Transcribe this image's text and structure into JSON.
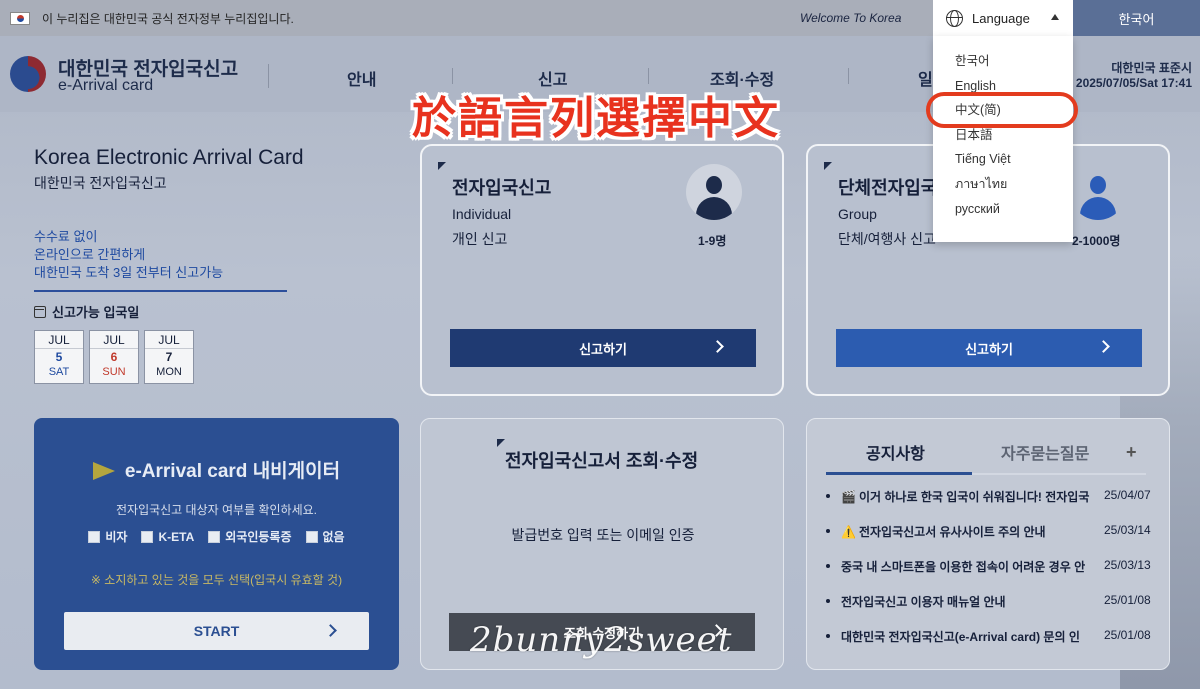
{
  "gov_banner": {
    "text": "이 누리집은 대한민국 공식 전자정부 누리집입니다.",
    "welcome": "Welcome To Korea",
    "language_label": "Language",
    "current_language": "한국어"
  },
  "header": {
    "title": "대한민국 전자입국신고",
    "subtitle": "e-Arrival card",
    "nav": [
      "안내",
      "신고",
      "조회·수정",
      "일"
    ],
    "time_label": "대한민국 표준시",
    "time_value": "2025/07/05/Sat 17:41"
  },
  "language_dropdown": {
    "items": [
      "한국어",
      "English",
      "中文(简)",
      "日本語",
      "Tiếng Việt",
      "ภาษาไทย",
      "русский"
    ],
    "highlighted_index": 2
  },
  "annotation": {
    "text": "於語言列選擇中文",
    "color": "#e8321e"
  },
  "intro": {
    "title": "Korea Electronic Arrival Card",
    "subtitle": "대한민국 전자입국신고",
    "points": [
      "수수료 없이",
      "온라인으로 간편하게",
      "대한민국 도착 3일 전부터 신고가능"
    ],
    "dates_label": "신고가능 입국일",
    "dates": [
      {
        "month": "JUL",
        "day": "5",
        "dow": "SAT",
        "color": "#1f4aa0"
      },
      {
        "month": "JUL",
        "day": "6",
        "dow": "SUN",
        "color": "#c0392b"
      },
      {
        "month": "JUL",
        "day": "7",
        "dow": "MON",
        "color": "#16203a"
      }
    ]
  },
  "individual_card": {
    "title": "전자입국신고",
    "type_en": "Individual",
    "type_ko": "개인 신고",
    "count": "1-9명",
    "button": "신고하기"
  },
  "group_card": {
    "title": "단체전자입국",
    "type_en": "Group",
    "type_ko": "단체/여행사 신고",
    "count": "2-1000명",
    "button": "신고하기"
  },
  "navigator": {
    "title": "e-Arrival card 내비게이터",
    "description": "전자입국신고 대상자 여부를 확인하세요.",
    "options": [
      "비자",
      "K-ETA",
      "외국인등록증",
      "없음"
    ],
    "note": "※ 소지하고 있는 것을 모두 선택(입국시 유효할 것)",
    "start": "START"
  },
  "lookup_card": {
    "title": "전자입국신고서 조회·수정",
    "description": "발급번호 입력 또는 이메일 인증",
    "button": "조회·수정하기"
  },
  "notices": {
    "tab_active": "공지사항",
    "tab_inactive": "자주묻는질문",
    "plus": "+",
    "items": [
      {
        "icon": "🎬",
        "text": "이거 하나로 한국 입국이 쉬워집니다! 전자입국",
        "date": "25/04/07"
      },
      {
        "icon": "⚠️",
        "text": "전자입국신고서 유사사이트 주의 안내",
        "date": "25/03/14"
      },
      {
        "icon": "",
        "text": "중국 내 스마트폰을 이용한 접속이 어려운 경우 안",
        "date": "25/03/13"
      },
      {
        "icon": "",
        "text": "전자입국신고 이용자 매뉴얼 안내",
        "date": "25/01/08"
      },
      {
        "icon": "",
        "text": "대한민국 전자입국신고(e-Arrival card) 문의 인",
        "date": "25/01/08"
      }
    ]
  },
  "watermark": "2bunny2sweet"
}
